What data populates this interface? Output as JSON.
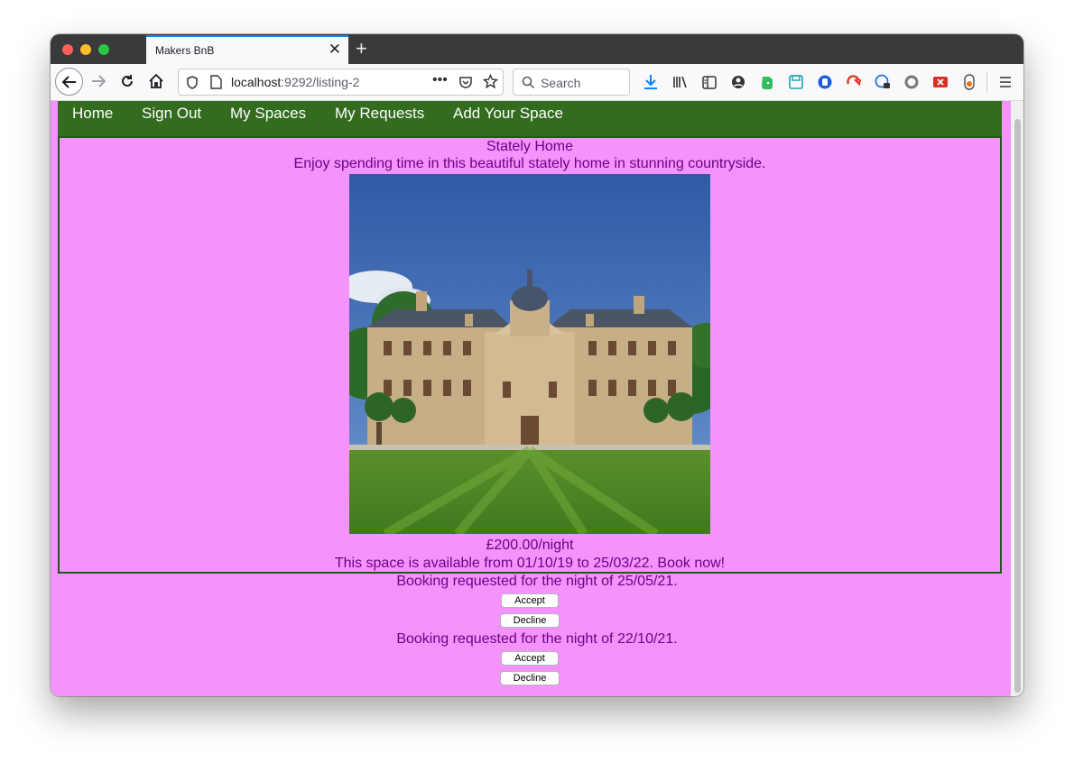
{
  "browser": {
    "tab_title": "Makers BnB",
    "url_host": "localhost",
    "url_rest": ":9292/listing-2",
    "search_placeholder": "Search"
  },
  "nav": {
    "items": [
      {
        "label": "Home"
      },
      {
        "label": "Sign Out"
      },
      {
        "label": "My Spaces"
      },
      {
        "label": "My Requests"
      },
      {
        "label": "Add Your Space"
      }
    ]
  },
  "listing": {
    "title": "Stately Home",
    "description": "Enjoy spending time in this beautiful stately home in stunning countryside.",
    "price": "£200.00/night",
    "availability": "This space is available from 01/10/19 to 25/03/22. Book now!"
  },
  "requests": [
    {
      "text": "Booking requested for the night of 25/05/21.",
      "accept_label": "Accept",
      "decline_label": "Decline"
    },
    {
      "text": "Booking requested for the night of 22/10/21.",
      "accept_label": "Accept",
      "decline_label": "Decline"
    }
  ],
  "colors": {
    "page_background": "#f393fb",
    "navbar": "#336b1f",
    "text": "#6c0287"
  }
}
